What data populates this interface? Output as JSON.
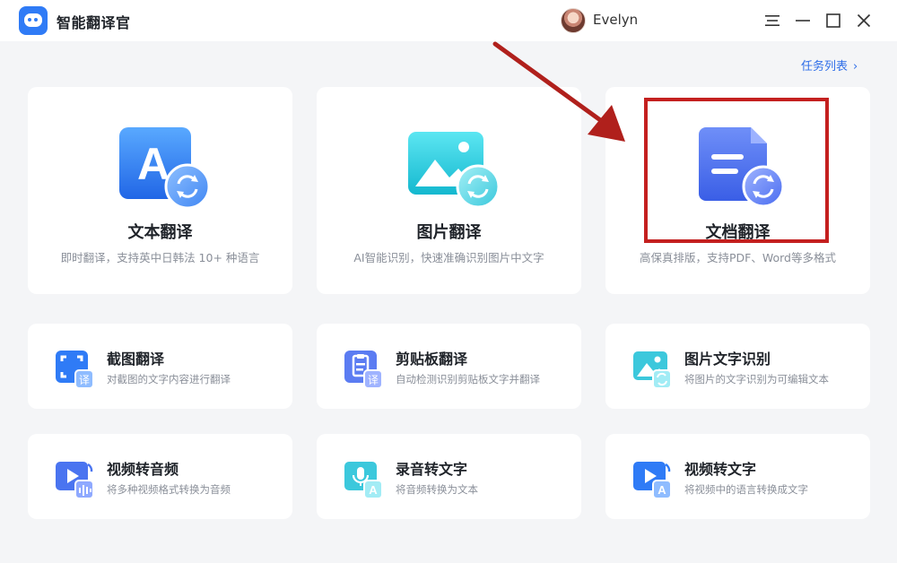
{
  "app": {
    "title": "智能翻译官",
    "user_name": "Evelyn",
    "task_list_label": "任务列表",
    "task_list_chevron": "›"
  },
  "window_controls": {
    "menu": "menu-icon",
    "minimize": "minimize-icon",
    "maximize": "maximize-icon",
    "close": "close-icon"
  },
  "main_features": [
    {
      "title": "文本翻译",
      "desc": "即时翻译，支持英中日韩法 10+ 种语言",
      "icon": "text-translate-icon",
      "icon_letter": "A"
    },
    {
      "title": "图片翻译",
      "desc": "AI智能识别，快速准确识别图片中文字",
      "icon": "image-translate-icon"
    },
    {
      "title": "文档翻译",
      "desc": "高保真排版，支持PDF、Word等多格式",
      "icon": "document-translate-icon"
    }
  ],
  "tools": [
    {
      "title": "截图翻译",
      "desc": "对截图的文字内容进行翻译",
      "icon": "screenshot-translate-icon",
      "badge": "译"
    },
    {
      "title": "剪贴板翻译",
      "desc": "自动检测识别剪贴板文字并翻译",
      "icon": "clipboard-translate-icon",
      "badge": "译"
    },
    {
      "title": "图片文字识别",
      "desc": "将图片的文字识别为可编辑文本",
      "icon": "image-ocr-icon"
    },
    {
      "title": "视频转音频",
      "desc": "将多种视频格式转换为音频",
      "icon": "video-to-audio-icon"
    },
    {
      "title": "录音转文字",
      "desc": "将音频转换为文本",
      "icon": "audio-to-text-icon",
      "badge": "A"
    },
    {
      "title": "视频转文字",
      "desc": "将视频中的语言转换成文字",
      "icon": "video-to-text-icon",
      "badge": "A"
    }
  ],
  "colors": {
    "accent": "#2f6ee8",
    "annotation_red": "#c4201f",
    "background": "#f4f5f7"
  }
}
